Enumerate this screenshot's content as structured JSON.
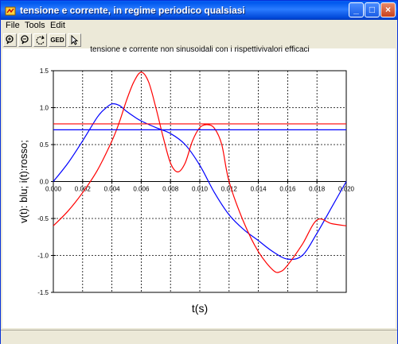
{
  "window": {
    "title": "tensione e corrente, in regime periodico qualsiasi",
    "controls": {
      "minimize": "_",
      "maximize": "□",
      "close": "×"
    }
  },
  "menu": [
    "File",
    "Tools",
    "Edit"
  ],
  "toolbar": {
    "buttons": [
      "zoom-in-icon",
      "zoom-out-icon",
      "rotate-icon",
      "ged",
      "pointer-icon"
    ],
    "ged_label": "GED"
  },
  "plot": {
    "title": "tensione e corrente non sinusoidali con i rispettivivalori efficaci",
    "xlabel": "t(s)",
    "ylabel": "v(t): blu; i(t):rosso;"
  },
  "chart_data": {
    "type": "line",
    "title": "tensione e corrente non sinusoidali con i rispettivivalori efficaci",
    "xlabel": "t(s)",
    "ylabel": "v(t): blu; i(t):rosso;",
    "xlim": [
      0,
      0.02
    ],
    "ylim": [
      -1.5,
      1.5
    ],
    "x_ticks": [
      "0.000",
      "0.002",
      "0.004",
      "0.006",
      "0.008",
      "0.010",
      "0.012",
      "0.014",
      "0.016",
      "0.018",
      "0.020"
    ],
    "y_ticks": [
      "-1.5",
      "-1.0",
      "-0.5",
      "0.0",
      "0.5",
      "1.0",
      "1.5"
    ],
    "grid": true,
    "colors": {
      "v": "#0000ff",
      "i": "#ff0000"
    },
    "series": [
      {
        "key": "v",
        "color": "#0000ff",
        "x": [
          0,
          0.001,
          0.002,
          0.003,
          0.0035,
          0.004,
          0.0045,
          0.005,
          0.0055,
          0.006,
          0.007,
          0.008,
          0.009,
          0.01,
          0.011,
          0.012,
          0.013,
          0.014,
          0.015,
          0.016,
          0.017,
          0.018,
          0.019,
          0.02
        ],
        "values": [
          0.0,
          0.25,
          0.55,
          0.87,
          0.98,
          1.05,
          1.03,
          0.95,
          0.88,
          0.82,
          0.73,
          0.65,
          0.5,
          0.22,
          -0.15,
          -0.45,
          -0.65,
          -0.8,
          -0.95,
          -1.05,
          -1.0,
          -0.7,
          -0.35,
          0.0
        ]
      },
      {
        "key": "i",
        "color": "#ff0000",
        "x": [
          0,
          0.001,
          0.002,
          0.003,
          0.004,
          0.0045,
          0.005,
          0.0055,
          0.006,
          0.0065,
          0.007,
          0.0075,
          0.008,
          0.0085,
          0.009,
          0.0095,
          0.01,
          0.0105,
          0.011,
          0.0115,
          0.012,
          0.013,
          0.014,
          0.015,
          0.0155,
          0.016,
          0.017,
          0.018,
          0.019,
          0.02
        ],
        "values": [
          -0.6,
          -0.4,
          -0.15,
          0.15,
          0.55,
          0.8,
          1.1,
          1.35,
          1.48,
          1.35,
          1.0,
          0.6,
          0.25,
          0.13,
          0.25,
          0.55,
          0.73,
          0.77,
          0.72,
          0.5,
          0.0,
          -0.55,
          -0.95,
          -1.2,
          -1.22,
          -1.13,
          -0.85,
          -0.52,
          -0.57,
          -0.6
        ]
      },
      {
        "key": "v_rms",
        "color": "#0000ff",
        "x": [
          0,
          0.02
        ],
        "values": [
          0.7,
          0.7
        ]
      },
      {
        "key": "i_rms",
        "color": "#ff0000",
        "x": [
          0,
          0.02
        ],
        "values": [
          0.78,
          0.78
        ]
      }
    ]
  },
  "statusbar": {
    "text": ""
  }
}
